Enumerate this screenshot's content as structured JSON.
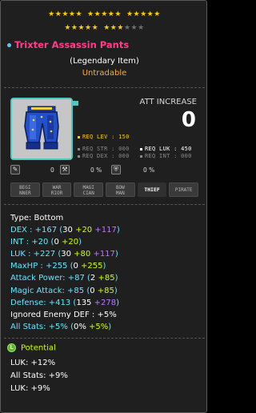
{
  "stars": {
    "row1": [
      "on",
      "on",
      "on",
      "on",
      "on",
      "gap",
      "on",
      "on",
      "on",
      "on",
      "on",
      "gap",
      "on",
      "on",
      "on",
      "on",
      "on"
    ],
    "row2": [
      "on",
      "on",
      "on",
      "on",
      "on",
      "gap",
      "on",
      "on",
      "on",
      "off",
      "off",
      "off"
    ]
  },
  "item": {
    "name": "Trixter Assassin Pants",
    "grade": "(Legendary Item)",
    "trade": "Untradable"
  },
  "att": {
    "label": "ATT INCREASE",
    "value": "0"
  },
  "requirements": {
    "lev": "REQ LEV : 150",
    "str": "REQ STR : 000",
    "dex": "REQ DEX : 000",
    "luk": "REQ LUK : 450",
    "int": "REQ INT : 000"
  },
  "icon_values": [
    "0",
    "0 %",
    "0 %"
  ],
  "jobs": [
    {
      "line1": "BEGI",
      "line2": "NNER"
    },
    {
      "line1": "WAR",
      "line2": "RIOR"
    },
    {
      "line1": "MAGI",
      "line2": "CIAN"
    },
    {
      "line1": "BOW",
      "line2": "MAN"
    },
    {
      "line1": "THIEF",
      "line2": ""
    },
    {
      "line1": "PIRATE",
      "line2": ""
    }
  ],
  "stats": {
    "type": "Type: Bottom",
    "dex": {
      "label": "DEX : +167 (",
      "base": "30",
      "bonus": " +20",
      "star": " +117",
      "end": ")"
    },
    "int": {
      "label": "INT : +20 (",
      "base": "0",
      "bonus": " +20",
      "end": ")"
    },
    "luk": {
      "label": "LUK : +227 (",
      "base": "30",
      "bonus": " +80",
      "star": " +117",
      "end": ")"
    },
    "maxhp": {
      "label": "MaxHP : +255 (",
      "base": "0",
      "bonus": " +255",
      "end": ")"
    },
    "attack": {
      "label": "Attack Power: +87 (",
      "base": "2",
      "bonus": " +85",
      "end": ")"
    },
    "magic": {
      "label": "Magic Attack: +85 (",
      "base": "0",
      "bonus": " +85",
      "end": ")"
    },
    "defense": {
      "label": "Defense: +413 (",
      "base": "135",
      "star": " +278",
      "end": ")"
    },
    "ied": "Ignored Enemy DEF : +5%",
    "allstats": {
      "label": "All Stats: +5% (",
      "base": "0%",
      "bonus": " +5%",
      "end": ")"
    }
  },
  "potential": {
    "title": "Potential",
    "icon_letter": "L",
    "lines": [
      "LUK: +12%",
      "All Stats: +9%",
      "LUK: +9%"
    ]
  },
  "colors": {
    "name": "#ff3d8a",
    "legendary_border": "#4ac9c0",
    "stat_cyan": "#64e7ff",
    "bonus_green": "#ccff00",
    "star_purple": "#bb77ff",
    "untradable": "#ffaa33"
  }
}
